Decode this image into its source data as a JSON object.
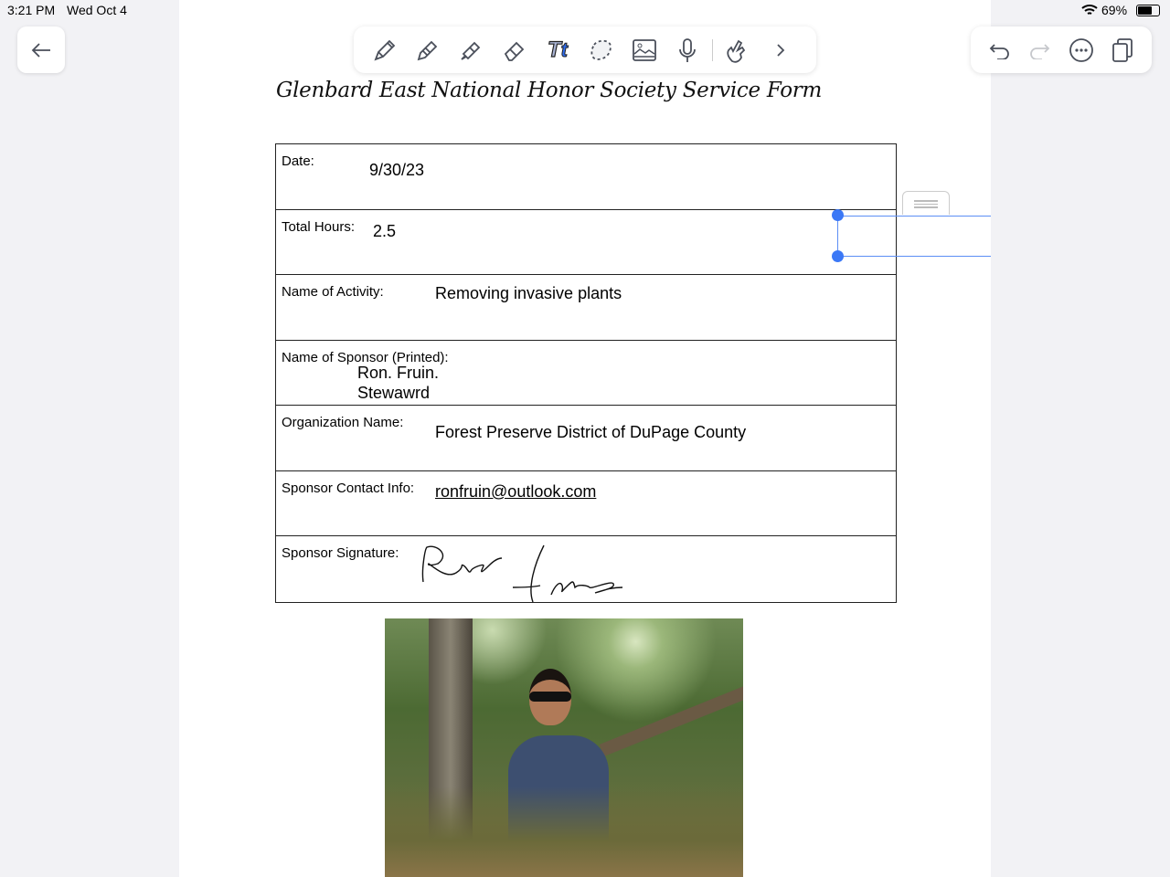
{
  "status": {
    "time": "3:21 PM",
    "date": "Wed Oct 4",
    "battery": "69%"
  },
  "toolbar": {
    "icons": [
      "pen-icon",
      "pencil-icon",
      "highlighter-icon",
      "eraser-icon",
      "text-icon",
      "lasso-icon",
      "image-icon",
      "microphone-icon",
      "touch-icon",
      "chevron-right-icon"
    ],
    "text_tool": "Tt"
  },
  "form": {
    "title": "Glenbard East National Honor Society Service Form",
    "rows": [
      {
        "label": "Date:",
        "value": "9/30/23"
      },
      {
        "label": "Total Hours:",
        "value": "2.5"
      },
      {
        "label": "Name of Activity:",
        "value": "Removing invasive plants"
      },
      {
        "label": "Name of Sponsor (Printed):",
        "value": "Ron. Fruin.",
        "value2": "Stewawrd"
      },
      {
        "label": "Organization Name:",
        "value": "Forest Preserve District of DuPage County"
      },
      {
        "label": "Sponsor Contact Info:",
        "value": "ronfruin@outlook.com"
      },
      {
        "label": "Sponsor Signature:"
      }
    ]
  },
  "colors": {
    "accent": "#3b78f6",
    "icon": "#4a4f5a"
  }
}
